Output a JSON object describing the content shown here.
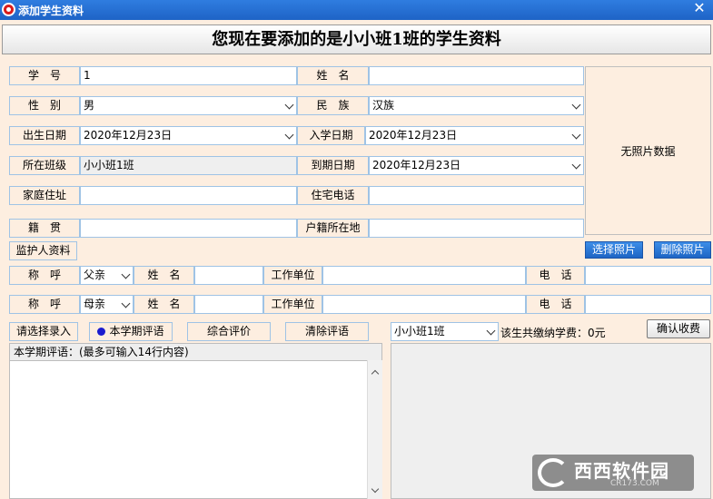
{
  "window": {
    "title": "添加学生资料",
    "close_glyph": "✕"
  },
  "headline": "您现在要添加的是小小班1班的学生资料",
  "form": {
    "student_no": {
      "label": "学　号",
      "value": "1"
    },
    "name": {
      "label": "姓　名",
      "value": ""
    },
    "gender": {
      "label": "性　别",
      "value": "男"
    },
    "ethnicity": {
      "label": "民　族",
      "value": "汉族"
    },
    "birth_date": {
      "label": "出生日期",
      "value": "2020年12月23日"
    },
    "enroll_date": {
      "label": "入学日期",
      "value": "2020年12月23日"
    },
    "class": {
      "label": "所在班级",
      "value": "小小班1班"
    },
    "expire_date": {
      "label": "到期日期",
      "value": "2020年12月23日"
    },
    "address": {
      "label": "家庭住址",
      "value": ""
    },
    "home_phone": {
      "label": "住宅电话",
      "value": ""
    },
    "native_place": {
      "label": "籍　贯",
      "value": ""
    },
    "household_reg": {
      "label": "户籍所在地",
      "value": ""
    }
  },
  "photo": {
    "placeholder": "无照片数据",
    "select_label": "选择照片",
    "delete_label": "删除照片"
  },
  "guardian": {
    "section_label": "监护人资料",
    "rows": [
      {
        "relation_label": "称　呼",
        "relation": "父亲",
        "name_label": "姓　名",
        "name": "",
        "work_label": "工作单位",
        "work": "",
        "phone_label": "电　话",
        "phone": ""
      },
      {
        "relation_label": "称　呼",
        "relation": "母亲",
        "name_label": "姓　名",
        "name": "",
        "work_label": "工作单位",
        "work": "",
        "phone_label": "电　话",
        "phone": ""
      }
    ]
  },
  "comment_toolbar": {
    "select_entry": "请选择录入",
    "this_term": "本学期评语",
    "overall": "综合评价",
    "clear": "清除评语"
  },
  "comment": {
    "header": "本学期评语：(最多可输入14行内容)",
    "value": ""
  },
  "fees": {
    "class_select": "小小班1班",
    "total_text": "该生共缴纳学费：0元",
    "confirm_label": "确认收费"
  },
  "watermark": {
    "brand": "西西软件园",
    "url": "CR173.COM"
  },
  "colors": {
    "titlebar": "#1e63c6",
    "panel_bg": "#fdeee0",
    "field_border": "#9fc3e5",
    "blue_button": "#2a78d8"
  }
}
